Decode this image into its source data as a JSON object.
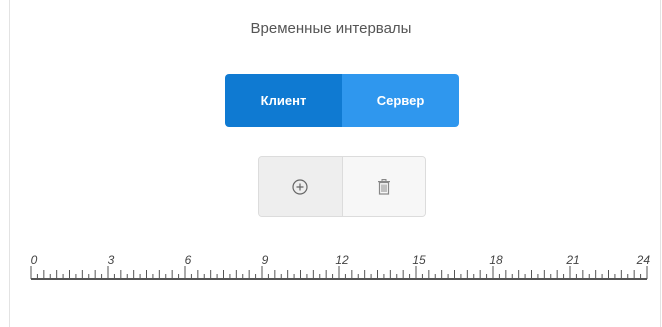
{
  "title": "Временные интервалы",
  "mode_switch": {
    "options": [
      "Клиент",
      "Сервер"
    ],
    "selected": "Клиент"
  },
  "toolbar": {
    "add_icon": "plus-circle-icon",
    "delete_icon": "trash-icon"
  },
  "timeline": {
    "labels": [
      "0",
      "3",
      "6",
      "9",
      "12",
      "15",
      "18",
      "21",
      "24"
    ],
    "start": 0,
    "end": 24
  },
  "colors": {
    "active": "#0f7ad2",
    "inactive": "#2f97ee",
    "ruler": "#555555"
  }
}
